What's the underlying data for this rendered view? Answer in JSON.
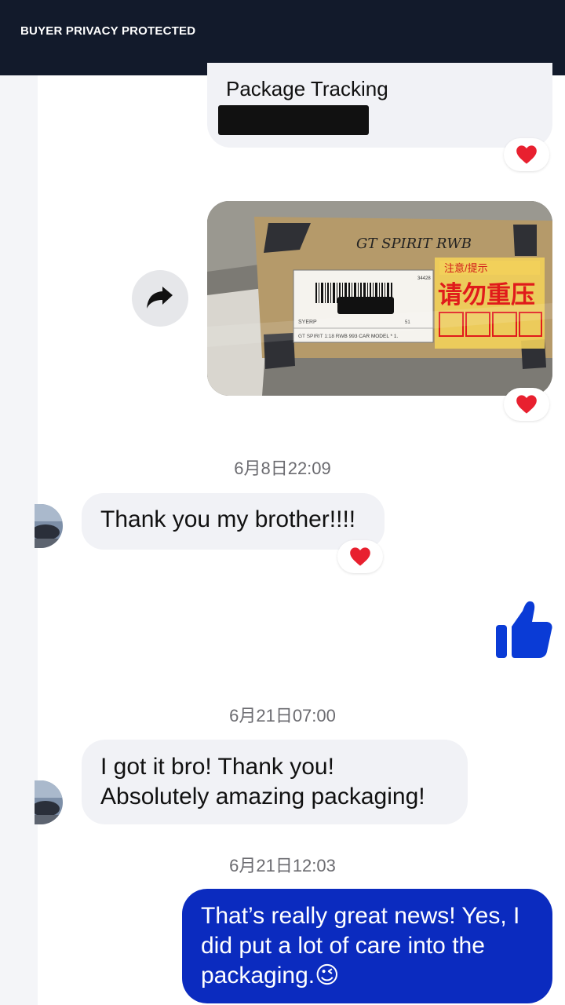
{
  "banner": {
    "text": "BUYER PRIVACY PROTECTED"
  },
  "messages": {
    "package": {
      "title": "Package Tracking"
    },
    "photo": {
      "handwriting": "GT SPIRIT RWB",
      "label_store": "SYERP",
      "label_item": "GT SPIRIT 1:18 RWB 993 CAR MODEL * 1.",
      "label_code": "34428",
      "label_num": "51",
      "sticker_top": "注意/提示",
      "sticker_main": "请勿重压"
    },
    "ts1": "6月8日22:09",
    "msg1": "Thank you my brother!!!!",
    "ts2": "6月21日07:00",
    "msg2_line1": "I got it bro! Thank you!",
    "msg2_line2": "Absolutely amazing packaging!",
    "ts3": "6月21日12:03",
    "reply": "That’s really great news! Yes, I did put a lot of care into the packaging.",
    "reply_emoji": "😉"
  },
  "colors": {
    "topbar": "#121a2b",
    "outgoing_bubble": "#0b2bbf",
    "incoming_bubble": "#f1f2f6",
    "thumb_like": "#0a3bd6",
    "heart": "#e8202f"
  },
  "icons": {
    "reaction": "heart-icon",
    "share": "share-arrow-icon",
    "like": "thumbs-up-icon"
  }
}
